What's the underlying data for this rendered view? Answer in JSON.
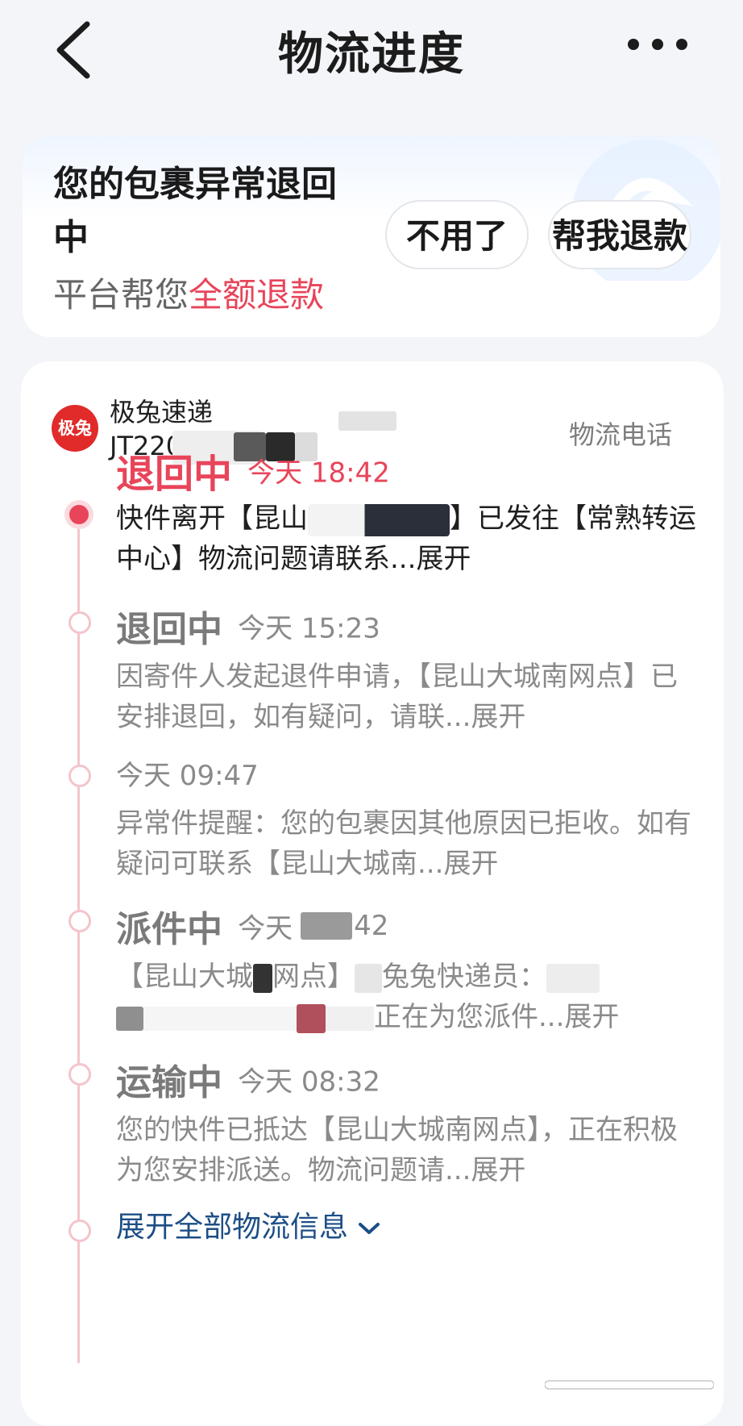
{
  "header": {
    "title": "物流进度",
    "back_icon": "chevron-left-icon",
    "more_icon": "more-dots-icon"
  },
  "banner": {
    "title": "您的包裹异常退回中",
    "subtitle_prefix": "平台帮您",
    "subtitle_highlight": "全额退款",
    "btn_decline": "不用了",
    "btn_refund": "帮我退款",
    "highlight_color": "#e8455a"
  },
  "carrier": {
    "logo_text": "极兔",
    "name": "极兔速递",
    "tracking_no_visible": "JT220",
    "phone_label": "物流电话"
  },
  "timeline": [
    {
      "status": "退回中",
      "time": "今天 18:42",
      "desc": "快件离开【昆山",
      "desc2": "】已发往【常熟转运中心】物流问题请联系...",
      "more": "展开",
      "active": true
    },
    {
      "status": "退回中",
      "time": "今天 15:23",
      "desc": "因寄件人发起退件申请，【昆山大城南网点】已安排退回，如有疑问，请联...",
      "more": "展开"
    },
    {
      "status": "",
      "time": "今天 09:47",
      "desc": "异常件提醒：您的包裹因其他原因已拒收。如有疑问可联系【昆山大城南...",
      "more": "展开"
    },
    {
      "status": "派件中",
      "time": "今天",
      "time_suffix": "42",
      "desc": "【昆山大城",
      "desc2": "网点】",
      "desc3": "兔兔快递员：",
      "desc4": "正在为您派件...",
      "more": "展开"
    },
    {
      "status": "运输中",
      "time": "今天 08:32",
      "desc": "您的快件已抵达【昆山大城南网点】，正在积极为您安排派送。物流问题请...",
      "more": "展开"
    }
  ],
  "expand_all": "展开全部物流信息",
  "colors": {
    "accent": "#e8455a",
    "link": "#1d4e86",
    "timeline": "#f3c5cc"
  }
}
